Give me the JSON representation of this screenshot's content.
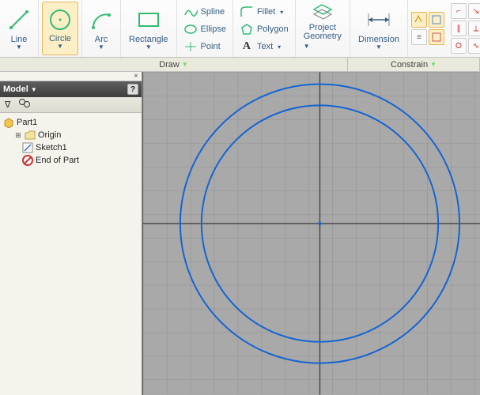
{
  "ribbon": {
    "line": "Line",
    "circle": "Circle",
    "arc": "Arc",
    "rectangle": "Rectangle",
    "spline": "Spline",
    "ellipse": "Ellipse",
    "point": "Point",
    "fillet": "Fillet",
    "polygon": "Polygon",
    "text": "Text",
    "project_geometry_l1": "Project",
    "project_geometry_l2": "Geometry",
    "dimension": "Dimension"
  },
  "panel_sections": {
    "draw": "Draw",
    "constrain": "Constrain"
  },
  "browser": {
    "title": "Model",
    "part": "Part1",
    "origin": "Origin",
    "sketch": "Sketch1",
    "end_of_part": "End of Part"
  },
  "chart_data": null
}
